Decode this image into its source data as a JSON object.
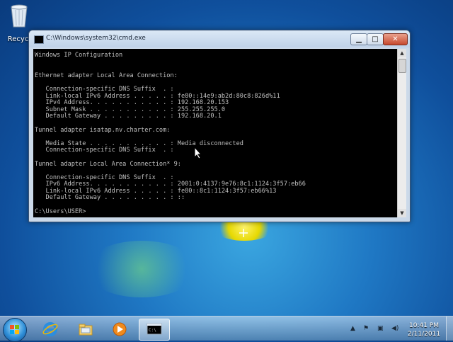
{
  "desktop": {
    "recycle_bin_label": "Recycle"
  },
  "window": {
    "title": "C:\\Windows\\system32\\cmd.exe",
    "minimize_icon": "minimize-icon",
    "maximize_icon": "maximize-icon",
    "close_icon": "close-icon",
    "console_lines": [
      "Windows IP Configuration",
      "",
      "",
      "Ethernet adapter Local Area Connection:",
      "",
      "   Connection-specific DNS Suffix  . :",
      "   Link-local IPv6 Address . . . . . : fe80::14e9:ab2d:80c8:826d%11",
      "   IPv4 Address. . . . . . . . . . . : 192.168.20.153",
      "   Subnet Mask . . . . . . . . . . . : 255.255.255.0",
      "   Default Gateway . . . . . . . . . : 192.168.20.1",
      "",
      "Tunnel adapter isatap.nv.charter.com:",
      "",
      "   Media State . . . . . . . . . . . : Media disconnected",
      "   Connection-specific DNS Suffix  . :",
      "",
      "Tunnel adapter Local Area Connection* 9:",
      "",
      "   Connection-specific DNS Suffix  . :",
      "   IPv6 Address. . . . . . . . . . . : 2001:0:4137:9e76:8c1:1124:3f57:eb66",
      "   Link-local IPv6 Address . . . . . : fe80::8c1:1124:3f57:eb66%13",
      "   Default Gateway . . . . . . . . . : ::",
      "",
      "C:\\Users\\USER>"
    ]
  },
  "taskbar": {
    "items": [
      "start-icon",
      "internet-explorer-icon",
      "windows-explorer-icon",
      "media-player-icon",
      "command-prompt-icon"
    ],
    "clock": {
      "time": "10:41 PM",
      "date": "2/11/2011"
    }
  }
}
